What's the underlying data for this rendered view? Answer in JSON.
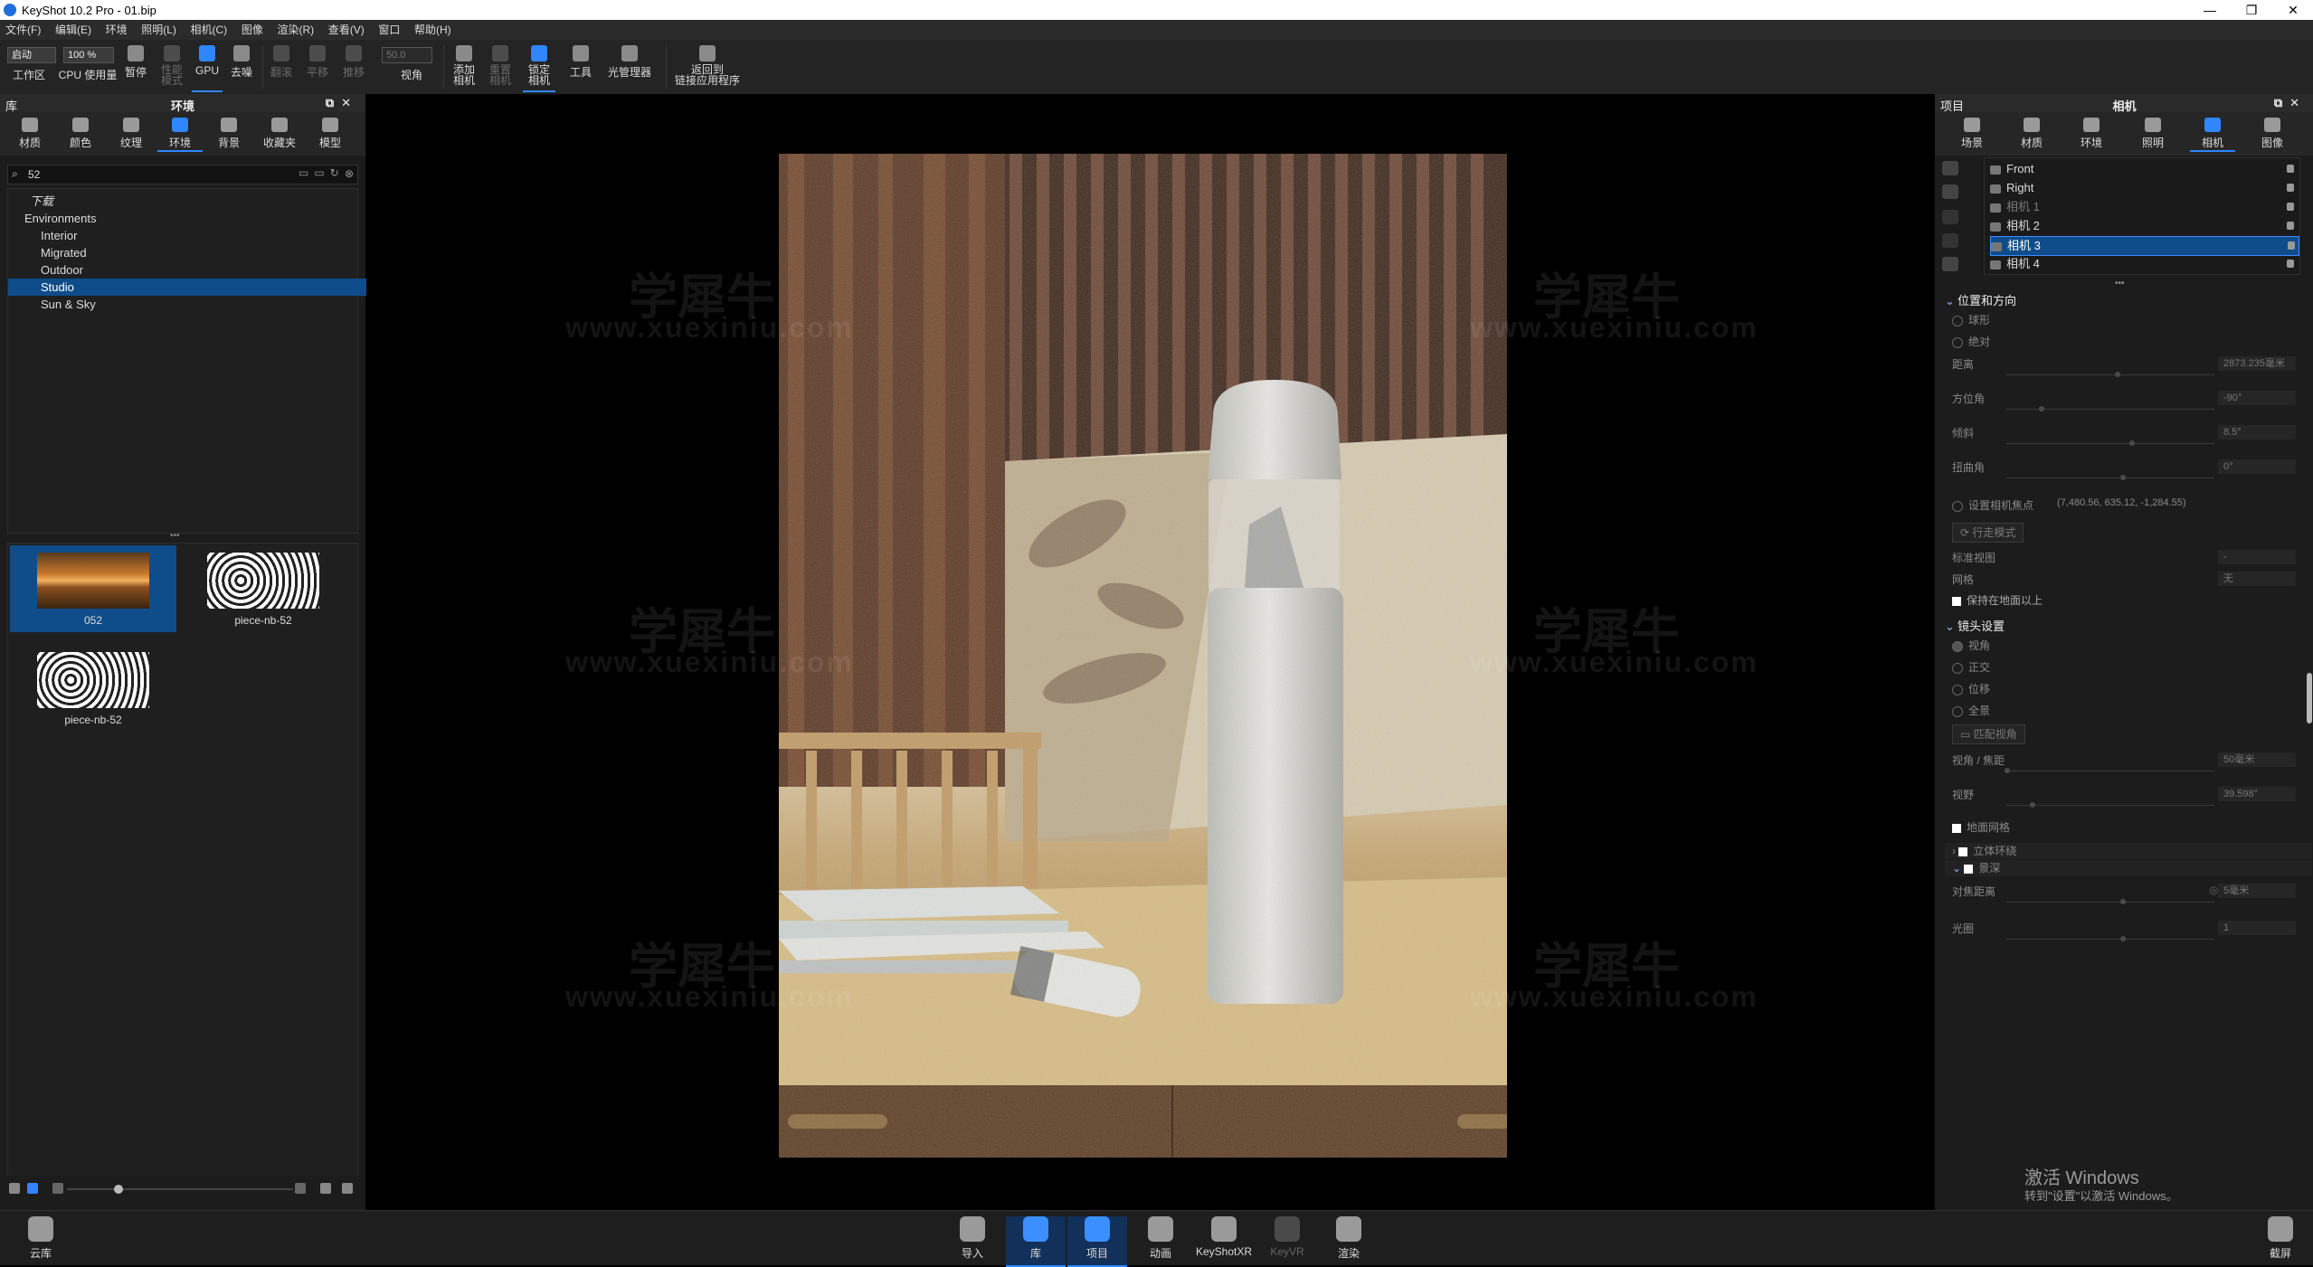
{
  "window": {
    "title": "KeyShot 10.2 Pro  -  01.bip",
    "controls": [
      "—",
      "❐",
      "✕"
    ]
  },
  "menubar": [
    "文件(F)",
    "编辑(E)",
    "环境",
    "照明(L)",
    "相机(C)",
    "图像",
    "渲染(R)",
    "查看(V)",
    "窗口",
    "帮助(H)"
  ],
  "ribbon": {
    "mode_select": "启动",
    "zoom_select": "100 %",
    "fov_value": "50.0",
    "buttons": {
      "workspace": "工作区",
      "cpu_usage": "CPU 使用量",
      "pause": "暂停",
      "perf_mode_1": "性能",
      "perf_mode_2": "模式",
      "gpu": "GPU",
      "denoise": "去噪",
      "tumble": "翻滚",
      "pan": "平移",
      "dolly": "推移",
      "fov": "视角",
      "add_camera_1": "添加",
      "add_camera_2": "相机",
      "reset_camera_1": "重置",
      "reset_camera_2": "相机",
      "lock_camera_1": "锁定",
      "lock_camera_2": "相机",
      "tools": "工具",
      "light_manager": "光管理器",
      "return_link_1": "返回到",
      "return_link_2": "链接应用程序"
    }
  },
  "library_panel": {
    "header_left": "库",
    "header_title": "环境",
    "tabs": [
      "材质",
      "颜色",
      "纹理",
      "环境",
      "背景",
      "收藏夹",
      "模型"
    ],
    "selected_tab": "环境",
    "search_value": "52",
    "tree": {
      "root_label": "下载",
      "environments": "Environments",
      "children": [
        "Interior",
        "Migrated",
        "Outdoor",
        "Studio",
        "Sun & Sky"
      ],
      "selected": "Studio"
    },
    "thumbnails": [
      {
        "label": "052",
        "selected": true,
        "kind": "hdri"
      },
      {
        "label": "piece-nb-52",
        "selected": false,
        "kind": "pattern"
      },
      {
        "label": "piece-nb-52",
        "selected": false,
        "kind": "pattern"
      }
    ]
  },
  "viewport": {
    "watermark_cn": "学犀牛",
    "watermark_url": "www.xuexiniu.com"
  },
  "project_panel": {
    "header_left": "项目",
    "header_title": "相机",
    "tabs": [
      "场景",
      "材质",
      "环境",
      "照明",
      "相机",
      "图像"
    ],
    "selected_tab": "相机",
    "cameras": [
      {
        "name": "Front",
        "dim": false,
        "selected": false
      },
      {
        "name": "Right",
        "dim": false,
        "selected": false
      },
      {
        "name": "相机 1",
        "dim": true,
        "selected": false
      },
      {
        "name": "相机 2",
        "dim": false,
        "selected": false
      },
      {
        "name": "相机 3",
        "dim": false,
        "selected": true
      },
      {
        "name": "相机 4",
        "dim": false,
        "selected": false
      }
    ],
    "position": {
      "section": "位置和方向",
      "mode_spherical": "球形",
      "mode_absolute": "绝对",
      "distance_label": "距离",
      "distance_value": "2873.235毫米",
      "azimuth_label": "方位角",
      "azimuth_value": "-90°",
      "inclination_label": "倾斜",
      "inclination_value": "8.5°",
      "twist_label": "扭曲角",
      "twist_value": "0°",
      "set_focus_label": "设置相机焦点",
      "focus_coords": "(7,480.56, 635.12, -1,284.55)",
      "walk_mode": "行走模式",
      "standard_view_label": "标准视图",
      "standard_view_value": "-",
      "grid_label": "网格",
      "grid_value": "无",
      "keep_above_ground": "保持在地面以上"
    },
    "lens": {
      "section": "镜头设置",
      "perspective": "视角",
      "orthographic": "正交",
      "shift": "位移",
      "panoramic": "全景",
      "match_perspective": "匹配视角",
      "fov_focal_label": "视角 / 焦距",
      "fov_focal_value": "50毫米",
      "field_of_view_label": "视野",
      "field_of_view_value": "39.598°",
      "ground_grid": "地面网格",
      "stereo": "立体环绕",
      "dof": "景深",
      "focus_distance_label": "对焦距离",
      "focus_distance_value": "5毫米",
      "aperture_label": "光圈",
      "aperture_value": "1"
    }
  },
  "activation": {
    "title": "激活 Windows",
    "subtitle": "转到\"设置\"以激活 Windows。"
  },
  "bottom_bar": {
    "cloud_library": "云库",
    "items": [
      "导入",
      "库",
      "项目",
      "动画",
      "KeyShotXR",
      "KeyVR",
      "渲染"
    ],
    "selected": [
      "库",
      "项目"
    ],
    "screenshot": "截屏"
  }
}
